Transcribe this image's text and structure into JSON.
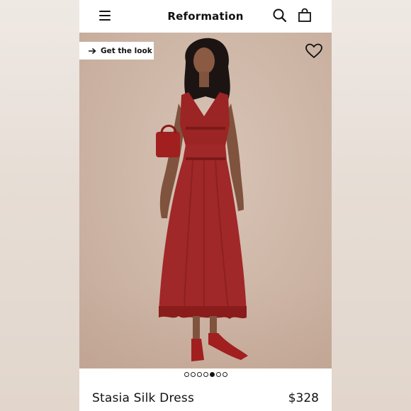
{
  "header": {
    "brand": "Reformation",
    "icons": [
      "menu-icon",
      "search-icon",
      "bag-icon"
    ]
  },
  "hero": {
    "get_the_look_label": "Get the look",
    "icons": [
      "arrow-right-icon",
      "heart-icon"
    ],
    "background_color": "#cdb5a5",
    "dress_color": "#9b2424"
  },
  "carousel": {
    "total": 7,
    "active_index": 4
  },
  "product": {
    "name": "Stasia Silk Dress",
    "price": "$328"
  }
}
